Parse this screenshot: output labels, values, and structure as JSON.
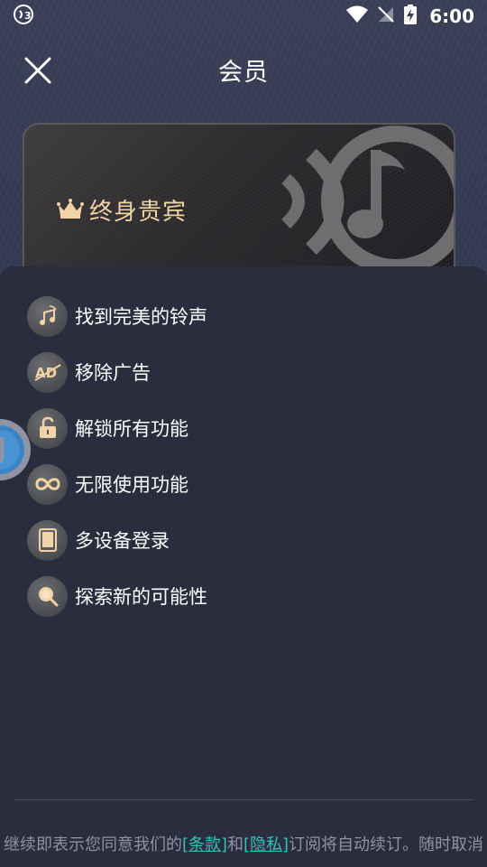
{
  "status_bar": {
    "time": "6:00",
    "icons": [
      "nfc-icon",
      "wifi-icon",
      "no-signal-icon",
      "battery-charging-icon"
    ]
  },
  "header": {
    "title": "会员",
    "close_icon": "close-icon"
  },
  "card": {
    "label": "终身贵宾",
    "crown_icon": "crown-icon",
    "logo_icon": "music-note-logo-icon"
  },
  "features": [
    {
      "label": "找到完美的铃声",
      "icon": "ringtone-icon"
    },
    {
      "label": "移除广告",
      "icon": "no-ads-icon"
    },
    {
      "label": "解锁所有功能",
      "icon": "unlock-icon"
    },
    {
      "label": "无限使用功能",
      "icon": "infinity-icon"
    },
    {
      "label": "多设备登录",
      "icon": "device-icon"
    },
    {
      "label": "探索新的可能性",
      "icon": "search-icon"
    }
  ],
  "footer": {
    "prefix": "继续即表示您同意我们的",
    "terms": "[条款]",
    "and": "和",
    "privacy": "[隐私]",
    "suffix": "订阅将自动续订。随时取消"
  },
  "colors": {
    "background": "#353a52",
    "sheet": "#2a2d3e",
    "gold": "#f1d3a5",
    "link": "#2ec4b6"
  }
}
